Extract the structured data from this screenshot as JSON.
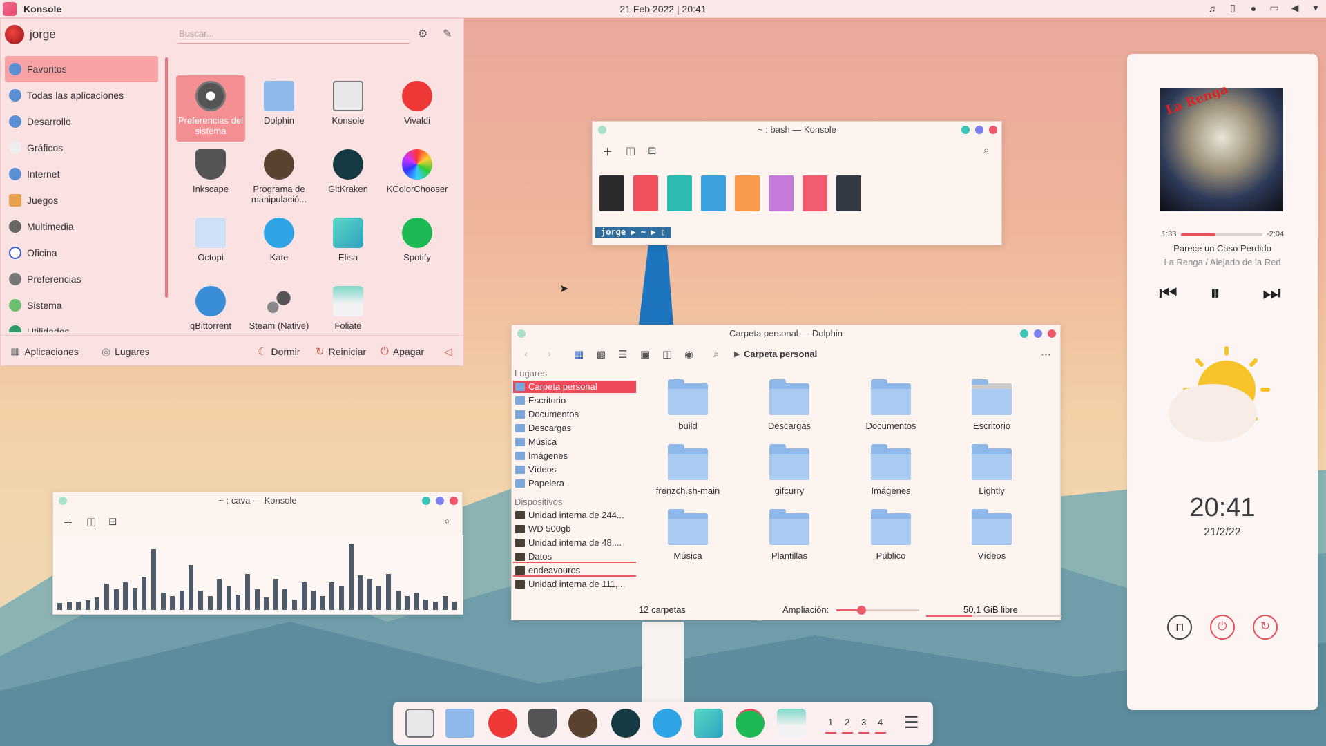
{
  "top_panel": {
    "app_title": "Konsole",
    "datetime": "21 Feb 2022 | 20:41",
    "tray_icons": [
      "notifications-icon",
      "battery-icon",
      "microphone-icon",
      "display-icon",
      "volume-icon",
      "chevron-down-icon"
    ]
  },
  "launcher": {
    "user": "jorge",
    "search_placeholder": "Buscar...",
    "categories": [
      {
        "label": "Favoritos"
      },
      {
        "label": "Todas las aplicaciones"
      },
      {
        "label": "Desarrollo"
      },
      {
        "label": "Gráficos"
      },
      {
        "label": "Internet"
      },
      {
        "label": "Juegos"
      },
      {
        "label": "Multimedia"
      },
      {
        "label": "Oficina"
      },
      {
        "label": "Preferencias"
      },
      {
        "label": "Sistema"
      },
      {
        "label": "Utilidades"
      }
    ],
    "apps": [
      {
        "label": "Preferencias del sistema",
        "icon": "settings-icon"
      },
      {
        "label": "Dolphin",
        "icon": "folder-icon"
      },
      {
        "label": "Konsole",
        "icon": "terminal-icon"
      },
      {
        "label": "Vivaldi",
        "icon": "vivaldi-icon"
      },
      {
        "label": "Inkscape",
        "icon": "inkscape-icon"
      },
      {
        "label": "Programa de manipulació...",
        "icon": "gimp-icon"
      },
      {
        "label": "GitKraken",
        "icon": "gitkraken-icon"
      },
      {
        "label": "KColorChooser",
        "icon": "color-wheel-icon"
      },
      {
        "label": "Octopi",
        "icon": "package-icon"
      },
      {
        "label": "Kate",
        "icon": "kate-icon"
      },
      {
        "label": "Elisa",
        "icon": "music-icon"
      },
      {
        "label": "Spotify",
        "icon": "spotify-icon"
      },
      {
        "label": "qBittorrent",
        "icon": "qbittorrent-icon"
      },
      {
        "label": "Steam (Native)",
        "icon": "steam-icon"
      },
      {
        "label": "Foliate",
        "icon": "book-icon"
      }
    ],
    "footer": {
      "applications": "Aplicaciones",
      "places": "Lugares",
      "sleep": "Dormir",
      "restart": "Reiniciar",
      "shutdown": "Apagar"
    }
  },
  "konsole_bash": {
    "title": "~ : bash — Konsole",
    "swatch_colors": [
      "#2b2b2b",
      "#f0505c",
      "#2bbbb0",
      "#3ba2dd",
      "#f89a4a",
      "#c47ad8",
      "#f25c70",
      "#343a44"
    ],
    "prompt_user": "jorge",
    "prompt_dir": "~"
  },
  "dolphin": {
    "title": "Carpeta personal — Dolphin",
    "breadcrumb": "Carpeta personal",
    "places_header": "Lugares",
    "places": [
      "Carpeta personal",
      "Escritorio",
      "Documentos",
      "Descargas",
      "Música",
      "Imágenes",
      "Vídeos",
      "Papelera"
    ],
    "devices_header": "Dispositivos",
    "devices": [
      "Unidad interna de 244...",
      "WD 500gb",
      "Unidad interna de 48,...",
      "Datos",
      "endeavouros",
      "Unidad interna de 111,..."
    ],
    "folders": [
      "build",
      "Descargas",
      "Documentos",
      "Escritorio",
      "frenzch.sh-main",
      "gifcurry",
      "Imágenes",
      "Lightly",
      "Música",
      "Plantillas",
      "Público",
      "Vídeos"
    ],
    "status_count": "12 carpetas",
    "zoom_label": "Ampliación:",
    "zoom_level": 0.3,
    "free_space": "50,1 GiB libre"
  },
  "konsole_cava": {
    "title": "~ : cava — Konsole",
    "bar_levels": [
      0.1,
      0.12,
      0.12,
      0.14,
      0.18,
      0.38,
      0.3,
      0.4,
      0.32,
      0.48,
      0.88,
      0.25,
      0.2,
      0.28,
      0.65,
      0.28,
      0.2,
      0.45,
      0.35,
      0.22,
      0.52,
      0.3,
      0.18,
      0.45,
      0.3,
      0.15,
      0.4,
      0.28,
      0.2,
      0.4,
      0.35,
      0.96,
      0.5,
      0.45,
      0.35,
      0.52,
      0.28,
      0.2,
      0.25,
      0.15,
      0.12,
      0.2,
      0.12
    ]
  },
  "media_widget": {
    "album_art_text": "La Renga",
    "elapsed": "1:33",
    "remaining": "-2:04",
    "progress": 0.42,
    "song": "Parece un Caso Perdido",
    "artist": "La Renga / Alejado de la Red",
    "clock": "20:41",
    "date": "21/2/22"
  },
  "dock": {
    "apps": [
      "terminal-icon",
      "folder-icon",
      "vivaldi-icon",
      "inkscape-icon",
      "gimp-icon",
      "gitkraken-icon",
      "kate-icon",
      "elisa-icon",
      "spotify-icon",
      "foliate-icon"
    ],
    "workspaces": [
      "1",
      "2",
      "3",
      "4"
    ]
  }
}
